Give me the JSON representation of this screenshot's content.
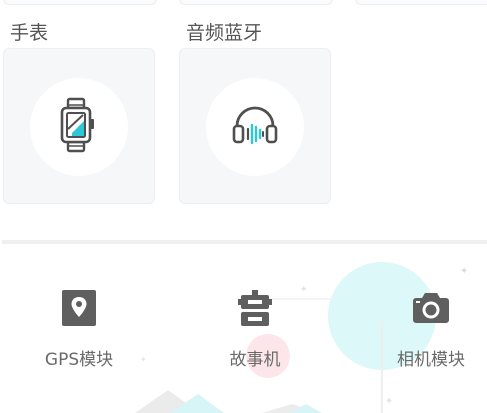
{
  "categories": [
    {
      "label": "手表",
      "icon": "smartwatch-icon"
    },
    {
      "label": "音频蓝牙",
      "icon": "headphones-icon"
    }
  ],
  "modules": [
    {
      "label": "GPS模块",
      "icon": "map-pin-icon"
    },
    {
      "label": "故事机",
      "icon": "robot-icon"
    },
    {
      "label": "相机模块",
      "icon": "camera-icon"
    }
  ],
  "colors": {
    "accent": "#2ec7d6",
    "icon_dark": "#5f5f5f",
    "card_bg": "#f6f7f9"
  }
}
